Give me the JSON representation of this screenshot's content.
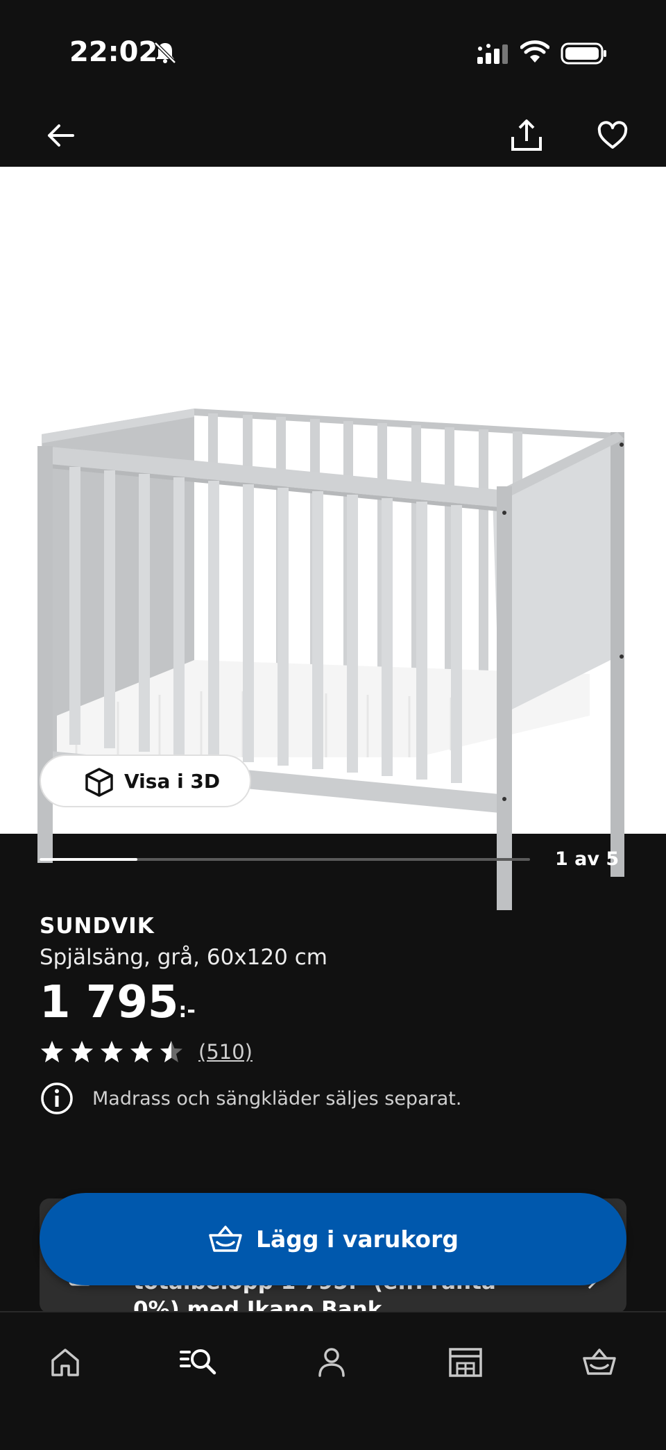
{
  "status_bar": {
    "time": "22:02"
  },
  "header": {
    "back_icon": "arrow-left-icon",
    "share_icon": "share-icon",
    "favorite_icon": "heart-icon"
  },
  "gallery": {
    "view_3d_label": "Visa i 3D",
    "counter": "1 av 5",
    "current_image": 1,
    "total_images": 5
  },
  "product": {
    "name": "SUNDVIK",
    "description": "Spjälsäng, grå, 60x120 cm",
    "price": "1 795",
    "price_suffix": ":-",
    "rating": 4.5,
    "review_count": "(510)",
    "notice": "Madrass och sängkläder säljes separat."
  },
  "financing": {
    "text": "totalbelopp 1 795:- (eff. ränta 0%) med Ikano Bank"
  },
  "cta": {
    "add_to_cart_label": "Lägg i varukorg"
  },
  "bottom_nav": {
    "items": [
      {
        "name": "home",
        "icon": "home-icon"
      },
      {
        "name": "search",
        "icon": "search-icon"
      },
      {
        "name": "profile",
        "icon": "user-icon"
      },
      {
        "name": "store",
        "icon": "store-icon"
      },
      {
        "name": "cart",
        "icon": "basket-icon"
      }
    ]
  },
  "colors": {
    "background": "#111111",
    "accent": "#0058ad",
    "card": "#2e2e2e"
  }
}
